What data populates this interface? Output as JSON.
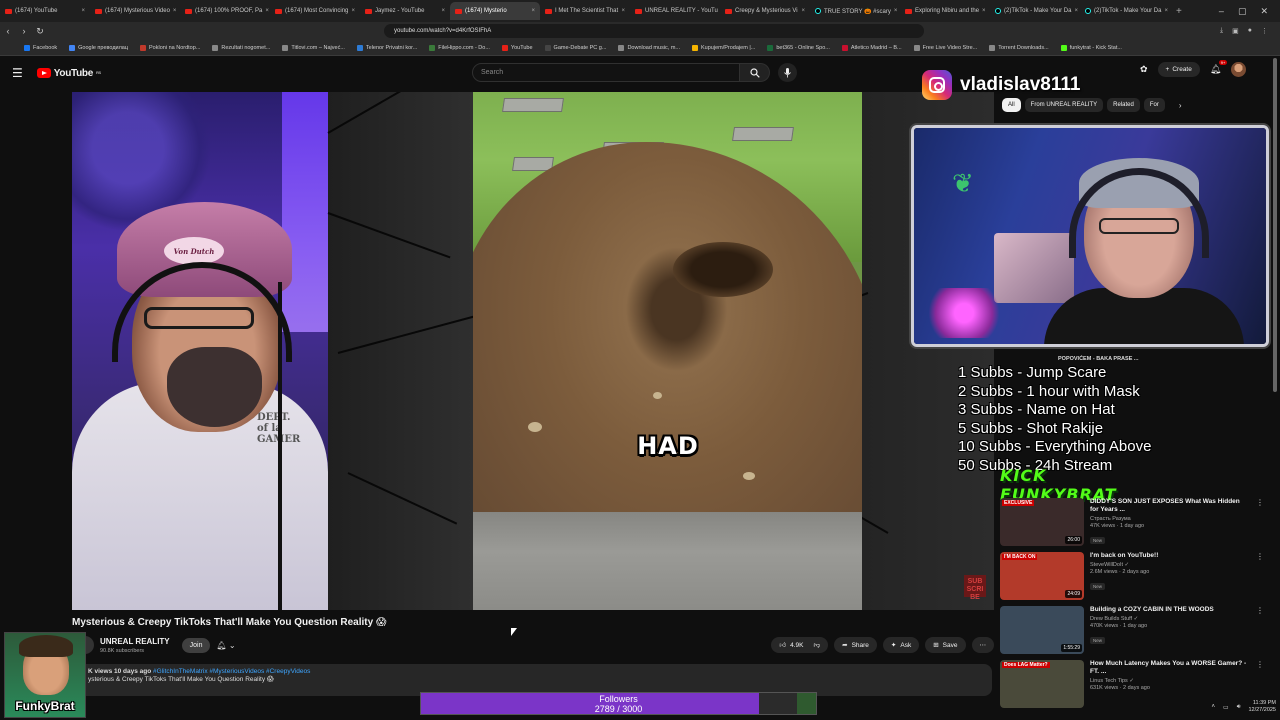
{
  "browser": {
    "tabs": [
      {
        "label": "(1674) YouTube",
        "type": "yt",
        "active": false
      },
      {
        "label": "(1674) Mysterious Video",
        "type": "yt",
        "active": false
      },
      {
        "label": "(1674) 100% PROOF, Pa",
        "type": "yt",
        "active": false
      },
      {
        "label": "(1674) Most Convincing",
        "type": "yt",
        "active": false
      },
      {
        "label": "Jaymez - YouTube",
        "type": "yt",
        "active": false
      },
      {
        "label": "(1674) Mysterio",
        "type": "yt",
        "active": true
      },
      {
        "label": "I Met The Scientist That",
        "type": "yt",
        "active": false
      },
      {
        "label": "UNREAL REALITY - YouTu",
        "type": "yt",
        "active": false
      },
      {
        "label": "Creepy & Mysterious Vi",
        "type": "yt",
        "active": false
      },
      {
        "label": "TRUE STORY 🎃 #scary",
        "type": "tk",
        "active": false
      },
      {
        "label": "Exploring Nibiru and the",
        "type": "yt",
        "active": false
      },
      {
        "label": "(2)TikTok - Make Your Da",
        "type": "tk",
        "active": false
      },
      {
        "label": "(2)TikTok - Make Your Da",
        "type": "tk",
        "active": false
      }
    ],
    "url": "youtube.com/watch?v=d4KrfOSIFhA",
    "bookmarks": [
      "Facebook",
      "Google преводилац",
      "Pokloni na Nordtop...",
      "Rezultati nogomet...",
      "Titlovi.com – Najveć...",
      "Telenor Privatni kor...",
      "FileHippo.com - Do...",
      "YouTube",
      "Game-Debate PC g...",
      "Download music, m...",
      "Kupujem/Prodajem |...",
      "bet365 - Online Spo...",
      "Atletico Madrid – B...",
      "Free Live Video Stre...",
      "Torrent Downloads...",
      "funkytrat - Kick Stat..."
    ]
  },
  "header": {
    "logo": "YouTube",
    "region": "RS",
    "search_placeholder": "Search",
    "create_label": "Create",
    "notif_count": "9+"
  },
  "video": {
    "caption": "HAD",
    "sub_badge": "SUB\nSCRIBE",
    "title": "Mysterious & Creepy TikToks That'll Make You Question Reality 😱",
    "channel": "UNREAL REALITY",
    "subscribers": "90.8K subscribers",
    "join_label": "Join",
    "likes": "4.9K",
    "share_label": "Share",
    "ask_label": "Ask",
    "save_label": "Save",
    "desc_meta": "K views  10 days ago",
    "desc_tags": "#GlitchInTheMatrix #MysteriousVideos #CreepyVideos",
    "desc_text": "ysterious & Creepy TikToks That'll Make You Question Reality 😱"
  },
  "chips": [
    "All",
    "From UNREAL REALITY",
    "Related",
    "For"
  ],
  "recommendations": [
    {
      "title": "DIDDY'S SON JUST EXPOSES What Was Hidden for Years ...",
      "channel": "Страсть Разума",
      "meta": "47K views · 1 day ago",
      "badge": "New",
      "duration": "26:00",
      "thumb_label": "EXCLUSIVE",
      "thumb_bg": "#3a2a2a"
    },
    {
      "title": "I'm back on YouTube!!",
      "channel": "SteveWillDoIt ✓",
      "meta": "2.6M views · 2 days ago",
      "badge": "New",
      "duration": "24:09",
      "thumb_label": "I'M BACK ON",
      "thumb_bg": "#b33a2a"
    },
    {
      "title": "Building a COZY CABIN IN THE WOODS",
      "channel": "Drew Builds Stuff ✓",
      "meta": "470K views · 1 day ago",
      "badge": "New",
      "duration": "1:55:29",
      "thumb_label": "",
      "thumb_bg": "#3a4a5a"
    },
    {
      "title": "How Much Latency Makes You a WORSE Gamer? - FT. ...",
      "channel": "Linus Tech Tips ✓",
      "meta": "631K views · 2 days ago",
      "badge": "",
      "duration": "",
      "thumb_label": "Does LAG Matter?",
      "thumb_bg": "#4a4a3a"
    }
  ],
  "stream": {
    "instagram_handle": "vladislav8111",
    "partial_text": "POPOVIĆEM - BAKA PRASE ...",
    "goals": [
      "1 Subbs - Jump Scare",
      "2 Subbs - 1 hour with Mask",
      "3 Subbs - Name on Hat",
      "5 Subbs - Shot Rakije",
      "10 Subbs - Everything Above",
      "50 Subbs - 24h Stream"
    ],
    "kick_text": "KICK FUNKYBRAT",
    "followers_title": "Followers",
    "followers_current": 2789,
    "followers_goal": 3000,
    "followers_text": "2789 / 3000",
    "streamer_name": "FunkyBrat"
  },
  "tray": {
    "time": "11:39 PM",
    "date": "12/27/2025"
  }
}
